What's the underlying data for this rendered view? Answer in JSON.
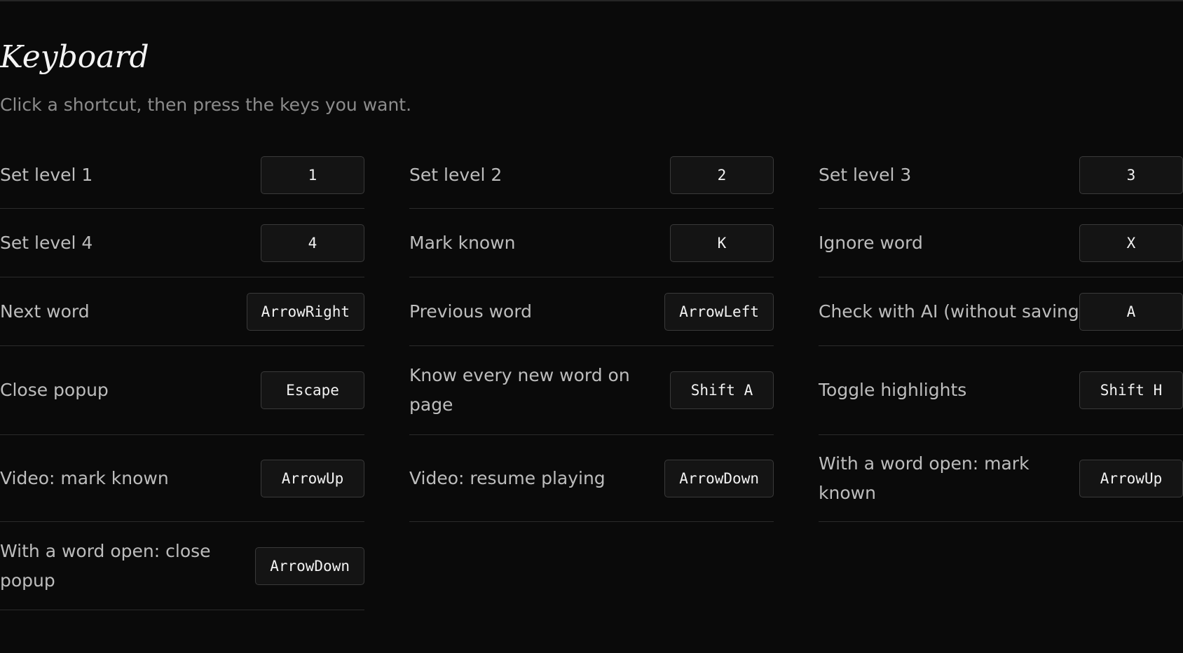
{
  "page": {
    "title": "Keyboard",
    "subtitle": "Click a shortcut, then press the keys you want."
  },
  "shortcuts": [
    {
      "label": "Set level 1",
      "key": "1"
    },
    {
      "label": "Set level 2",
      "key": "2"
    },
    {
      "label": "Set level 3",
      "key": "3"
    },
    {
      "label": "Set level 4",
      "key": "4"
    },
    {
      "label": "Mark known",
      "key": "K"
    },
    {
      "label": "Ignore word",
      "key": "X"
    },
    {
      "label": "Next word",
      "key": "ArrowRight"
    },
    {
      "label": "Previous word",
      "key": "ArrowLeft"
    },
    {
      "label": "Check with AI (without saving)",
      "key": "A"
    },
    {
      "label": "Close popup",
      "key": "Escape"
    },
    {
      "label": "Know every new word on page",
      "key": "Shift A"
    },
    {
      "label": "Toggle highlights",
      "key": "Shift H"
    },
    {
      "label": "Video: mark known",
      "key": "ArrowUp"
    },
    {
      "label": "Video: resume playing",
      "key": "ArrowDown"
    },
    {
      "label": "With a word open: mark known",
      "key": "ArrowUp"
    },
    {
      "label": "With a word open: close popup",
      "key": "ArrowDown"
    }
  ],
  "colors": {
    "background": "#0a0a0a",
    "key_background": "#141414",
    "key_border": "#3a3a3a",
    "divider": "#2b2b2b",
    "title": "#f4f4f4",
    "subtitle": "#8c8c8c",
    "label": "#bdbdbd"
  }
}
